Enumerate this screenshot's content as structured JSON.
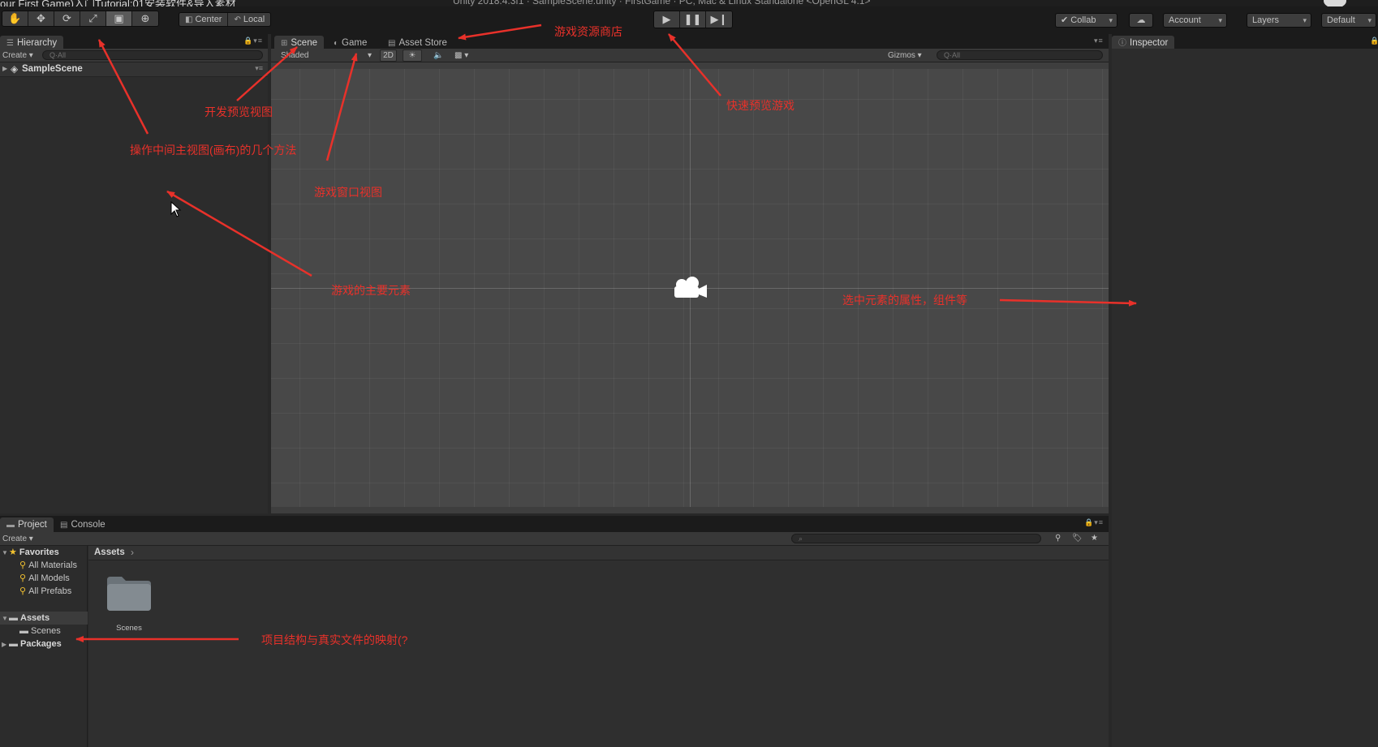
{
  "window": {
    "title_left": "our First Game)入门Tutorial:01安装软件&导入素材",
    "title_center": "Unity 2018.4.3f1 · SampleScene.unity · FirstGame · PC, Mac & Linux Standalone <OpenGL 4.1>"
  },
  "toolbar": {
    "tools": [
      {
        "name": "hand",
        "icon": "hand-icon",
        "glyph": "✋"
      },
      {
        "name": "move",
        "icon": "move-icon",
        "glyph": "✥"
      },
      {
        "name": "rotate",
        "icon": "rotate-icon",
        "glyph": "⟳"
      },
      {
        "name": "scale",
        "icon": "scale-icon",
        "glyph": "⤢"
      },
      {
        "name": "rect",
        "icon": "rect-tool-icon",
        "glyph": "▣"
      },
      {
        "name": "transform",
        "icon": "transform-icon",
        "glyph": "⊕"
      }
    ],
    "pivot_label": "Center",
    "space_label": "Local",
    "collab_label": "Collab",
    "account_label": "Account",
    "layers_label": "Layers",
    "layout_label": "Default"
  },
  "hierarchy": {
    "tab_label": "Hierarchy",
    "create_label": "Create",
    "search_placeholder": "Q·All",
    "scene_name": "SampleScene"
  },
  "scene_tabs": {
    "scene": "Scene",
    "game": "Game",
    "asset_store": "Asset Store"
  },
  "scene_toolbar": {
    "shading_mode": "Shaded",
    "mode_2d": "2D",
    "gizmos_label": "Gizmos",
    "search_placeholder": "Q·All"
  },
  "inspector": {
    "tab_label": "Inspector"
  },
  "project": {
    "tab_project": "Project",
    "tab_console": "Console",
    "create_label": "Create",
    "favorites_label": "Favorites",
    "favorites": [
      "All Materials",
      "All Models",
      "All Prefabs"
    ],
    "assets_label": "Assets",
    "assets_children": [
      "Scenes"
    ],
    "packages_label": "Packages",
    "breadcrumb": "Assets",
    "folder_name": "Scenes"
  },
  "annotations": {
    "asset_store": "游戏资源商店",
    "play_preview": "快速预览游戏",
    "scene_view": "开发预览视图",
    "tools": "操作中间主视图(画布)的几个方法",
    "game_view": "游戏窗口视图",
    "hierarchy": "游戏的主要元素",
    "inspector": "选中元素的属性，组件等",
    "project": "项目结构与真实文件的映射(?"
  },
  "colors": {
    "annotation_red": "#e8312a",
    "panel_bg": "#2c2c2c",
    "scene_bg": "#484848",
    "toolbar_bg": "#1b1b1b"
  }
}
